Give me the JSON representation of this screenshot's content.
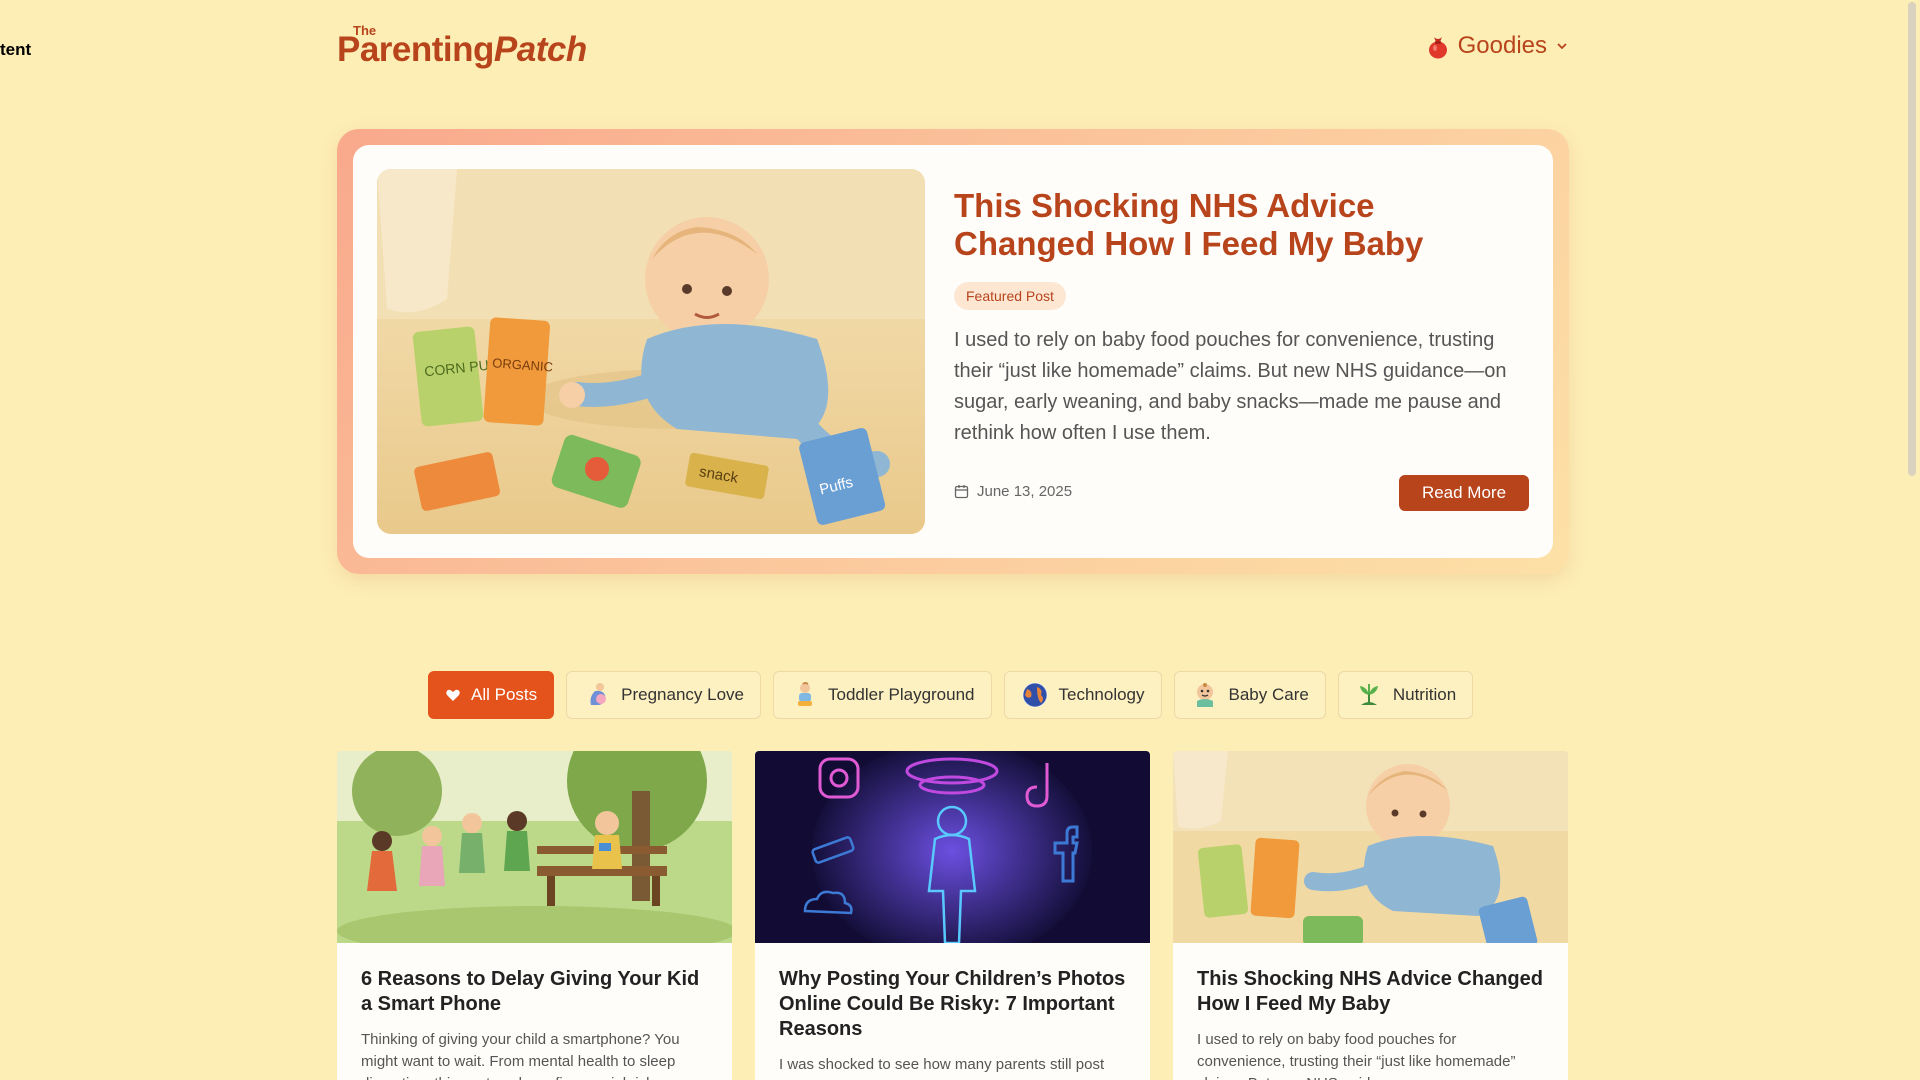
{
  "skip_link": "tent",
  "header": {
    "logo_the": "The",
    "logo_parenting": "Parenting",
    "logo_patch": "Patch",
    "goodies_label": "Goodies",
    "goodies_icon": "gift-bag-icon"
  },
  "featured": {
    "title": "This Shocking NHS Advice Changed How I Feed My Baby",
    "badge": "Featured Post",
    "excerpt": "I used to rely on baby food pouches for convenience, trusting their “just like homemade” claims. But new NHS guidance—on sugar, early weaning, and baby snacks—made me pause and rethink how often I use them.",
    "date": "June 13, 2025",
    "read_more": "Read More",
    "image_labels": [
      "CORN PUFFS",
      "ORGANIC",
      "snack",
      "Puffs"
    ]
  },
  "tabs": [
    {
      "label": "All Posts",
      "icon": "heart-icon",
      "active": true
    },
    {
      "label": "Pregnancy Love",
      "icon": "pregnancy-icon",
      "active": false
    },
    {
      "label": "Toddler Playground",
      "icon": "toddler-icon",
      "active": false
    },
    {
      "label": "Technology",
      "icon": "globe-icon",
      "active": false
    },
    {
      "label": "Baby Care",
      "icon": "baby-icon",
      "active": false
    },
    {
      "label": "Nutrition",
      "icon": "plant-icon",
      "active": false
    }
  ],
  "posts": [
    {
      "title": "6 Reasons to Delay Giving Your Kid a Smart Phone",
      "excerpt": "Thinking of giving your child a smartphone? You might want to wait. From mental health to sleep disruption, this post explores five crucial risks."
    },
    {
      "title": "Why Posting Your Children’s Photos Online Could Be Risky: 7 Important Reasons",
      "excerpt": "I was shocked to see how many parents still post photos of their kids online every single day."
    },
    {
      "title": "This Shocking NHS Advice Changed How I Feed My Baby",
      "excerpt": "I used to rely on baby food pouches for convenience, trusting their “just like homemade” claims. But new NHS guidance—on sugar."
    }
  ],
  "colors": {
    "background": "#fdeeb6",
    "brand": "#b8441c",
    "active_tab": "#e4531c"
  }
}
